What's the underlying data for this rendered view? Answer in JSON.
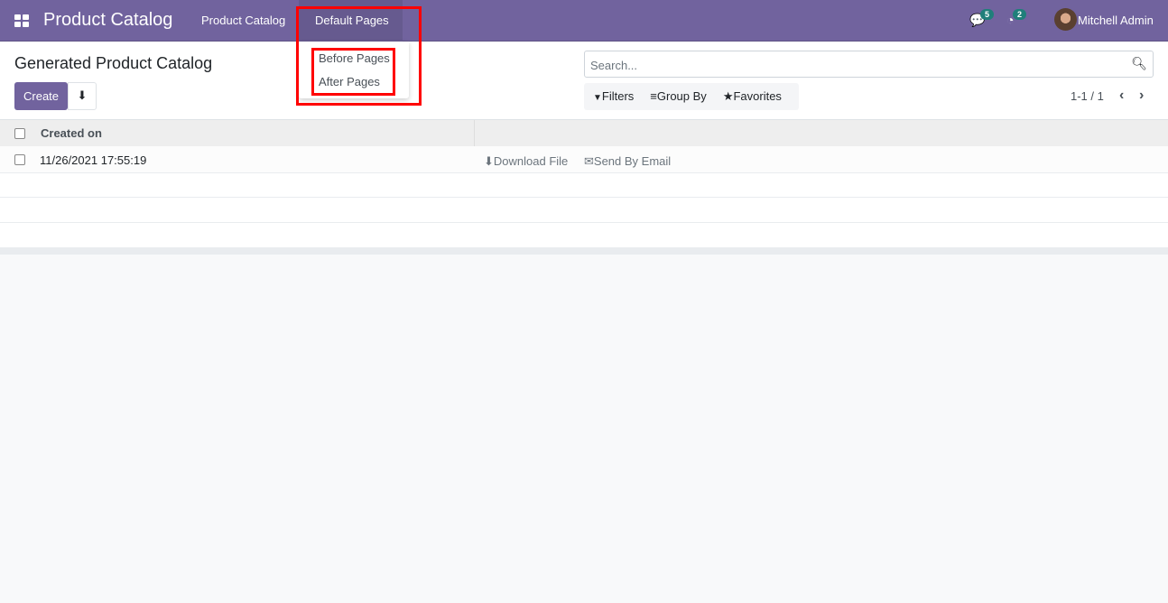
{
  "nav": {
    "brand": "Product Catalog",
    "menu": [
      "Product Catalog",
      "Default Pages"
    ],
    "messages_count": "5",
    "activities_count": "2",
    "user": "Mitchell Admin"
  },
  "dropdown": {
    "items": [
      "Before Pages",
      "After Pages"
    ]
  },
  "page": {
    "title": "Generated Product Catalog",
    "create": "Create"
  },
  "search": {
    "placeholder": "Search..."
  },
  "filters": {
    "filters": "Filters",
    "group_by": "Group By",
    "favorites": "Favorites"
  },
  "pager": "1-1 / 1",
  "table": {
    "header": "Created on",
    "rows": [
      {
        "created_on": "11/26/2021 17:55:19",
        "download": "Download File",
        "email": "Send By Email"
      }
    ]
  },
  "colors": {
    "brand": "#71639e",
    "highlight": "#ff0000"
  }
}
